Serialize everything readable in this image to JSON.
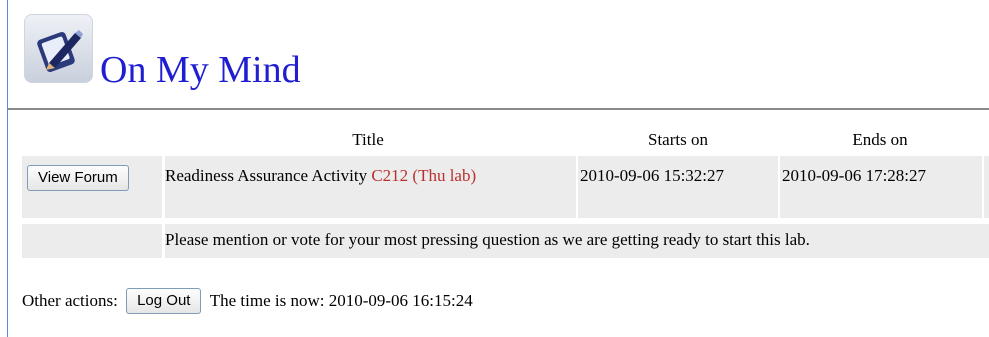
{
  "header": {
    "title": "On My Mind",
    "logo_icon": "pencil-notepad-icon"
  },
  "table": {
    "columns": [
      "Title",
      "Starts on",
      "Ends on"
    ],
    "row": {
      "button_label": "View Forum",
      "title_text": "Readiness Assurance Activity",
      "title_room": "C212 (Thu lab)",
      "starts_on": "2010-09-06 15:32:27",
      "ends_on": "2010-09-06 17:28:27"
    },
    "description": "Please mention or vote for your most pressing question as we are getting ready to start this lab."
  },
  "footer": {
    "other_actions_label": "Other actions:",
    "logout_label": "Log Out",
    "time_label": "The time is now: 2010-09-06 16:15:24"
  },
  "colors": {
    "title": "#1f1fd1",
    "room": "#b8312f",
    "row_bg": "#ececec"
  }
}
